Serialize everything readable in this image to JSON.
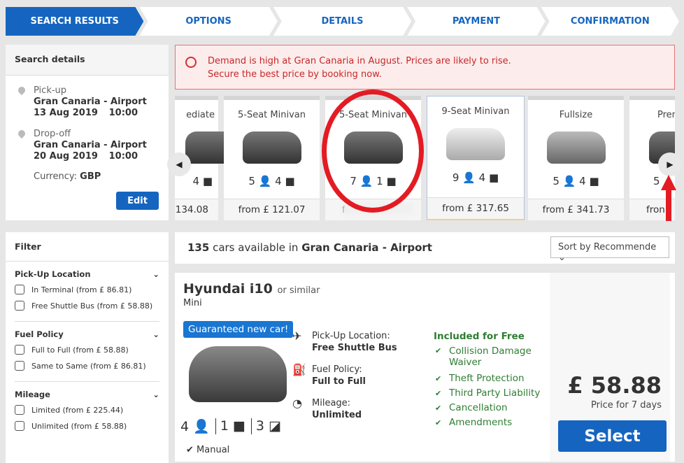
{
  "steps": [
    "SEARCH RESULTS",
    "OPTIONS",
    "DETAILS",
    "PAYMENT",
    "CONFIRMATION"
  ],
  "search": {
    "title": "Search details",
    "pickup_label": "Pick-up",
    "pickup_loc": "Gran Canaria - Airport",
    "pickup_date": "13 Aug 2019",
    "pickup_time": "10:00",
    "dropoff_label": "Drop-off",
    "dropoff_loc": "Gran Canaria - Airport",
    "dropoff_date": "20 Aug 2019",
    "dropoff_time": "10:00",
    "currency_label": "Currency:",
    "currency": "GBP",
    "edit": "Edit"
  },
  "alert": {
    "line1": "Demand is high at Gran Canaria in August. Prices are likely to rise.",
    "line2": "Secure the best price by booking now."
  },
  "categories": [
    {
      "title": "ediate",
      "feat": "4 ■",
      "price": "134.08"
    },
    {
      "title": "5-Seat Minivan",
      "feat": "5 👤 4 ■",
      "price": "from £ 121.07"
    },
    {
      "title": "5-Seat Minivan",
      "feat": "7 👤 1 ■",
      "price": "fr"
    },
    {
      "title": "9-Seat Minivan",
      "feat": "9 👤 4 ■",
      "price": "from £ 317.65"
    },
    {
      "title": "Fullsize",
      "feat": "5 👤 4 ■",
      "price": "from £ 341.73"
    },
    {
      "title": "Pren",
      "feat": "5",
      "price": "fron"
    }
  ],
  "filter": {
    "title": "Filter",
    "groups": [
      {
        "title": "Pick-Up Location",
        "options": [
          "In Terminal (from £ 86.81)",
          "Free Shuttle Bus (from £ 58.88)"
        ]
      },
      {
        "title": "Fuel Policy",
        "options": [
          "Full to Full (from £ 58.88)",
          "Same to Same (from £ 86.81)"
        ]
      },
      {
        "title": "Mileage",
        "options": [
          "Limited (from £ 225.44)",
          "Unlimited (from £ 58.88)"
        ]
      }
    ]
  },
  "results": {
    "count": "135",
    "count_text": " cars available in ",
    "location": "Gran Canaria - Airport",
    "sort": "Sort by Recommende"
  },
  "car": {
    "model": "Hyundai i10",
    "similar": "or similar",
    "class": "Mini",
    "badge": "Guaranteed new car!",
    "seats": "4",
    "bags": "1",
    "doors": "3",
    "transmission": "Manual",
    "pickup_label": "Pick-Up Location:",
    "pickup_value": "Free Shuttle Bus",
    "fuel_label": "Fuel Policy:",
    "fuel_value": "Full to Full",
    "mileage_label": "Mileage:",
    "mileage_value": "Unlimited",
    "included_title": "Included for Free",
    "included": [
      "Collision Damage Waiver",
      "Theft Protection",
      "Third Party Liability",
      "Cancellation",
      "Amendments"
    ],
    "price": "£ 58.88",
    "price_note": "Price for 7 days",
    "select": "Select"
  },
  "colors": {
    "primary": "#1565c0",
    "alert": "#c62828",
    "included": "#2e7d32",
    "annotation": "#e31b23"
  }
}
